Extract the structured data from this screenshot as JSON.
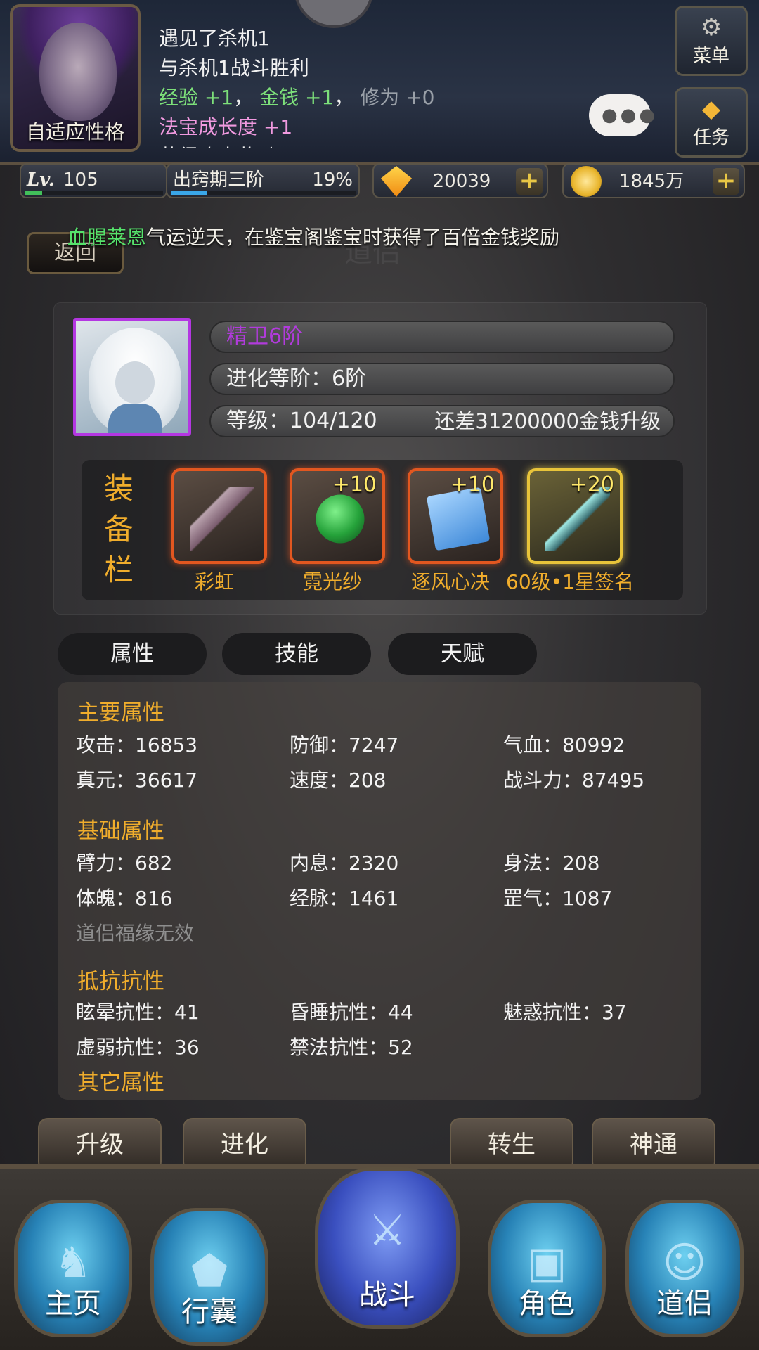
{
  "header": {
    "avatar_caption": "自适应性格",
    "log": {
      "line1": "遇见了杀机1",
      "line2": "与杀机1战斗胜利",
      "exp_label": "经验",
      "exp_value": "+1",
      "sep1": "，",
      "money_label": "金钱",
      "money_value": "+1",
      "sep2": "，",
      "cult_label": "修为",
      "cult_value": "+0",
      "growth_label": "法宝成长度",
      "growth_value": "+1",
      "line5": "获得攻击奖励"
    },
    "chat_icon": "speech-bubble-icon",
    "menu_label": "菜单",
    "menu_icon": "gear-icon",
    "task_label": "任务",
    "task_icon": "gem-icon"
  },
  "stats": {
    "level_prefix": "Lv.",
    "level": "105",
    "level_progress": 0.12,
    "stage_name": "出窍期三阶",
    "stage_percent": "19%",
    "stage_progress": 0.19,
    "gems": "20039",
    "gold": "1845万",
    "plus": "+"
  },
  "broadcast": {
    "player": "血腥莱恩",
    "message": "气运逆天，在鉴宝阁鉴宝时获得了百倍金钱奖励"
  },
  "back_label": "返回",
  "page_title_ghost": "道侣",
  "pet": {
    "name": "精卫6阶",
    "evolution": "进化等阶：6阶",
    "level": "等级：104/120",
    "upgrade_need": "还差31200000金钱升级",
    "name_color": "#b13bdc"
  },
  "equipment": {
    "title": [
      "装",
      "备",
      "栏"
    ],
    "slots": [
      {
        "label": "彩虹",
        "plus": "",
        "icon": "claw-icon"
      },
      {
        "label": "霓光纱",
        "plus": "+10",
        "icon": "orb-icon"
      },
      {
        "label": "逐风心决",
        "plus": "+10",
        "icon": "book-icon"
      },
      {
        "label": "60级•1星签名",
        "plus": "+20",
        "icon": "blade-icon"
      }
    ]
  },
  "tabs": [
    "属性",
    "技能",
    "天赋"
  ],
  "attributes": {
    "main_title": "主要属性",
    "main": [
      "攻击：16853",
      "防御：7247",
      "气血：80992",
      "真元：36617",
      "速度：208",
      "战斗力：87495"
    ],
    "base_title": "基础属性",
    "base": [
      "臂力：682",
      "内息：2320",
      "身法：208",
      "体魄：816",
      "经脉：1461",
      "罡气：1087"
    ],
    "base_note": "道侣福缘无效",
    "resist_title": "抵抗抗性",
    "resist": [
      "眩晕抗性：41",
      "昏睡抗性：44",
      "魅惑抗性：37",
      "虚弱抗性：36",
      "禁法抗性：52"
    ],
    "other_title": "其它属性"
  },
  "actions": [
    "升级",
    "进化",
    "转生",
    "神通"
  ],
  "nav": [
    {
      "label": "主页",
      "icon": "horse-icon"
    },
    {
      "label": "行囊",
      "icon": "bag-icon"
    },
    {
      "label": "战斗",
      "icon": "sword-icon"
    },
    {
      "label": "角色",
      "icon": "chest-icon"
    },
    {
      "label": "道侣",
      "icon": "companion-icon"
    }
  ],
  "colors": {
    "accent_orange": "#f0ad2c",
    "log_green": "#7de07a",
    "broadcast_name": "#56e36c"
  }
}
